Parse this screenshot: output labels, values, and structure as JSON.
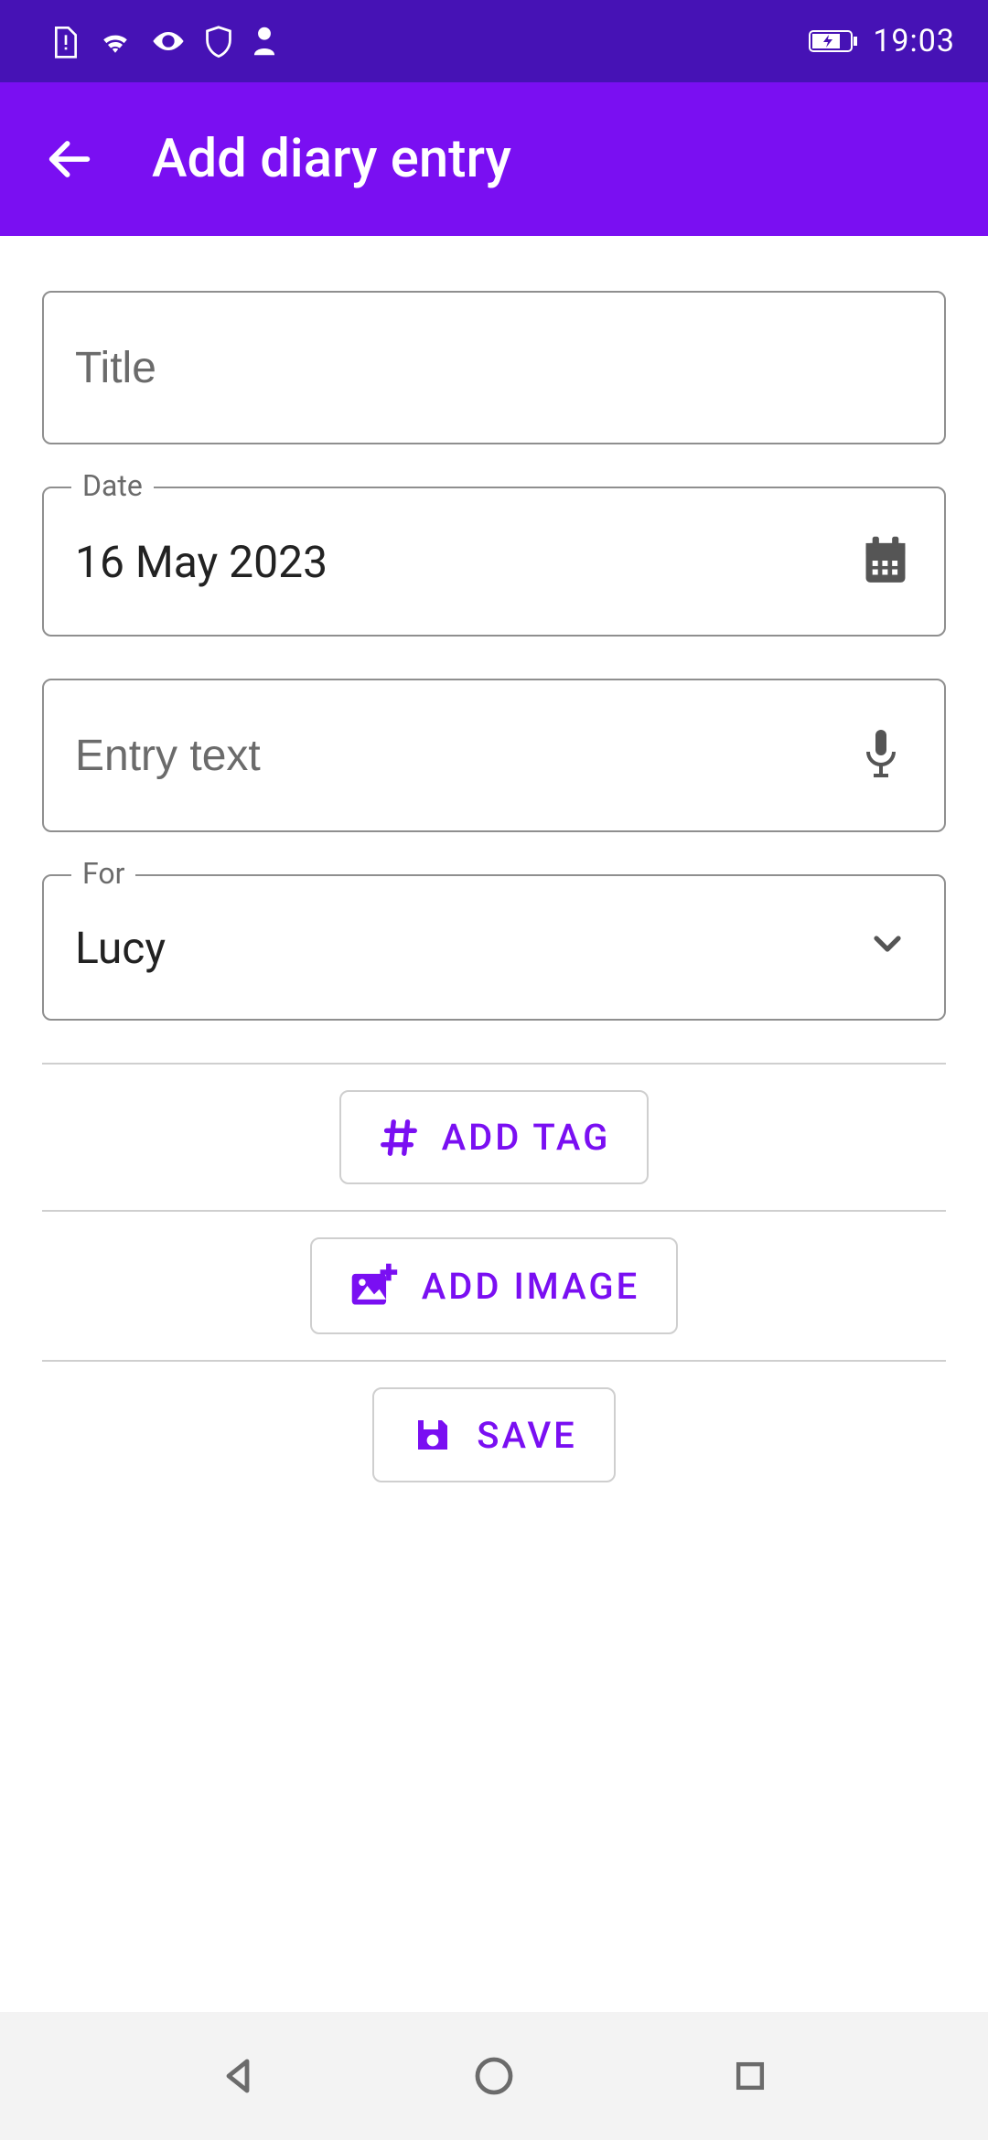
{
  "status": {
    "time": "19:03"
  },
  "appbar": {
    "title": "Add diary entry"
  },
  "fields": {
    "title_placeholder": "Title",
    "title_value": "",
    "date_label": "Date",
    "date_value": "16 May 2023",
    "entry_placeholder": "Entry text",
    "entry_value": "",
    "for_label": "For",
    "for_value": "Lucy"
  },
  "buttons": {
    "add_tag": "ADD TAG",
    "add_image": "ADD IMAGE",
    "save": "SAVE"
  },
  "colors": {
    "primary": "#7a0ff2",
    "primary_dark": "#4612b5"
  }
}
